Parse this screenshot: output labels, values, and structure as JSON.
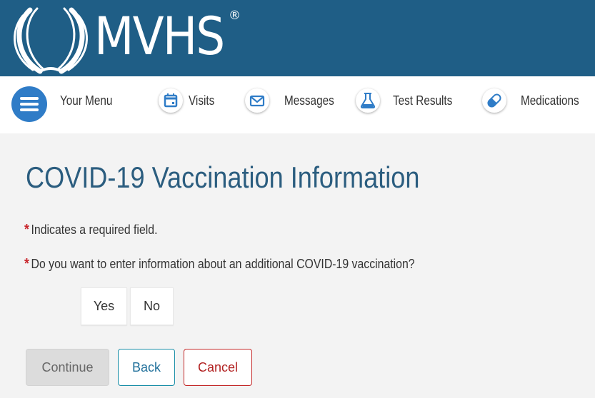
{
  "brand": {
    "logo_text": "MVHS",
    "registered_mark": "®",
    "header_color": "#1f5e86"
  },
  "nav": {
    "menu": {
      "label": "Your Menu",
      "icon": "hamburger-icon"
    },
    "items": [
      {
        "label": "Visits",
        "icon": "calendar-icon"
      },
      {
        "label": "Messages",
        "icon": "envelope-icon"
      },
      {
        "label": "Test Results",
        "icon": "flask-icon"
      },
      {
        "label": "Medications",
        "icon": "pill-icon"
      }
    ]
  },
  "page": {
    "title": "COVID-19 Vaccination Information",
    "required_note": "Indicates a required field.",
    "required_marker": "*",
    "question": "Do you want to enter information about an additional COVID-19 vaccination?",
    "options": [
      "Yes",
      "No"
    ]
  },
  "actions": {
    "continue_label": "Continue",
    "back_label": "Back",
    "cancel_label": "Cancel"
  },
  "colors": {
    "accent": "#2f7cc7",
    "title": "#2b5d7f",
    "required": "#c8262c",
    "cancel": "#b22222"
  }
}
